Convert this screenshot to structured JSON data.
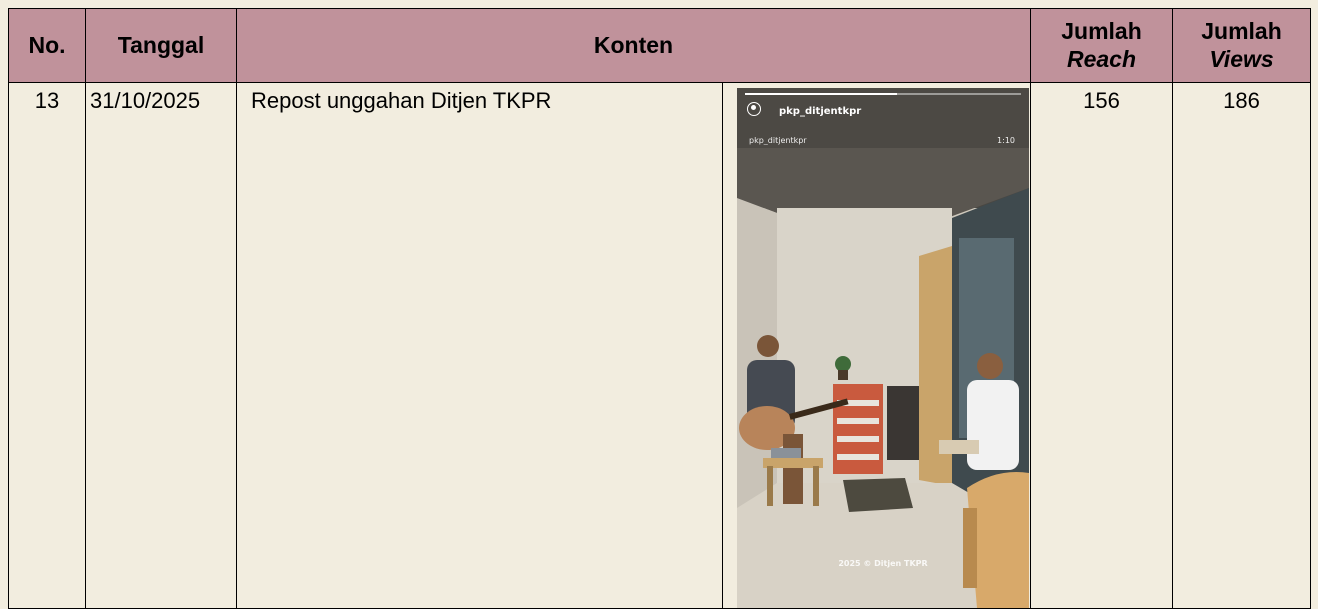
{
  "table": {
    "headers": {
      "no": "No.",
      "tanggal": "Tanggal",
      "konten": "Konten",
      "reach_top": "Jumlah",
      "reach_bottom": "Reach",
      "views_top": "Jumlah",
      "views_bottom": "Views"
    },
    "rows": [
      {
        "no": "13",
        "tanggal": "31/10/2025",
        "konten": "Repost unggahan Ditjen TKPR",
        "reach": "156",
        "views": "186",
        "thumbnail": {
          "username": "pkp_ditjentkpr",
          "username_sub": "pkp_ditjentkpr",
          "duration": "1:10",
          "watermark": "2025 © Ditjen TKPR",
          "progress": 0.55,
          "avatar_icon": "user-circle-icon"
        }
      }
    ]
  },
  "colors": {
    "header_bg": "#c0929b",
    "page_bg": "#f2eddf"
  }
}
